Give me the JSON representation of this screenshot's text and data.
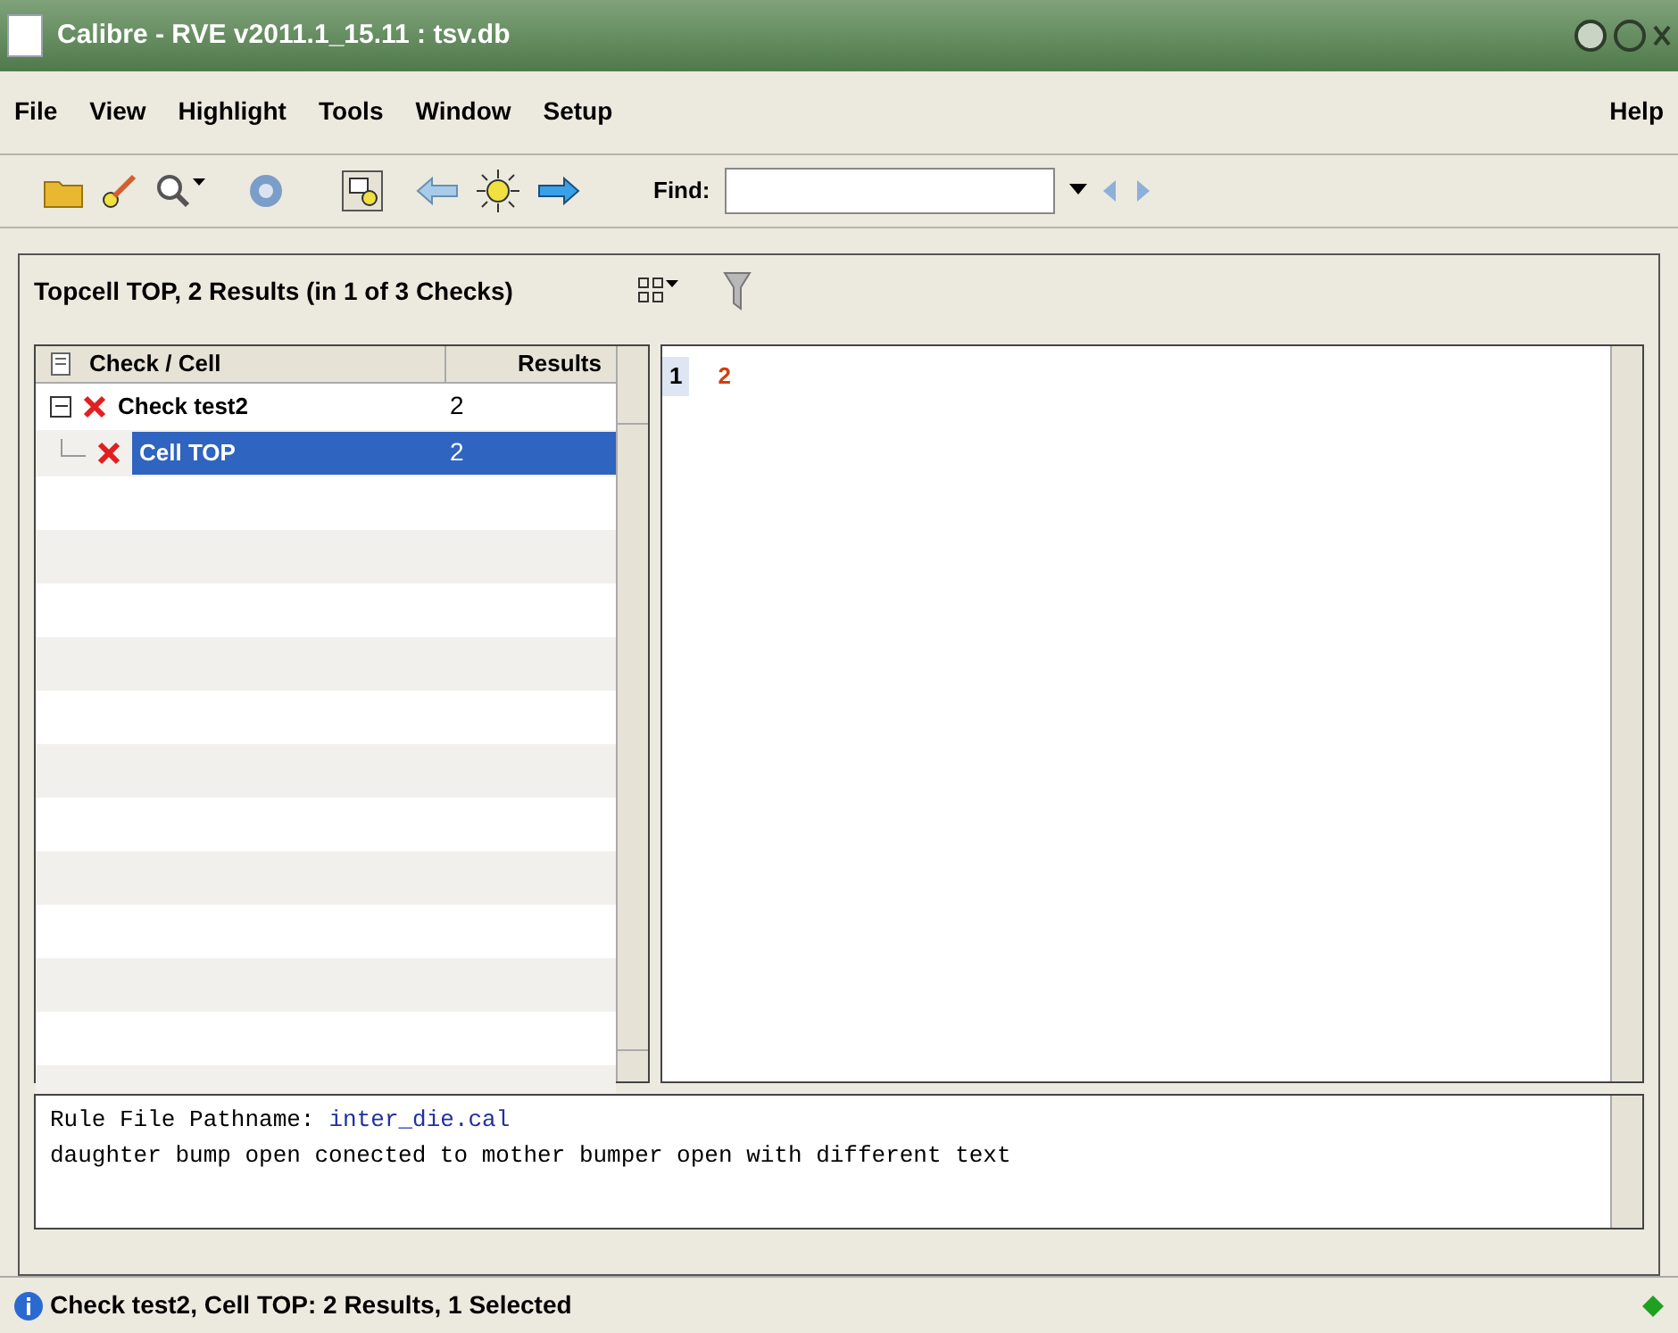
{
  "window": {
    "title": "Calibre - RVE v2011.1_15.11 : tsv.db"
  },
  "menu": [
    {
      "label": "File"
    },
    {
      "label": "View"
    },
    {
      "label": "Highlight"
    },
    {
      "label": "Tools"
    },
    {
      "label": "Window"
    },
    {
      "label": "Setup"
    }
  ],
  "help_menu": {
    "label": "Help"
  },
  "find": {
    "label": "Find:"
  },
  "summary": {
    "text": "Topcell TOP, 2 Results (in 1 of 3 Checks)"
  },
  "tree": {
    "columns": [
      "Check / Cell",
      "Results"
    ],
    "rows": [
      {
        "name": "Check test2",
        "results": "2",
        "selected": false,
        "expanded": true,
        "children": [
          {
            "name": "Cell TOP",
            "results": "2",
            "selected": true
          }
        ]
      }
    ]
  },
  "results": [
    {
      "index": "1",
      "value": "2"
    }
  ],
  "details": {
    "label": "Rule File Pathname:",
    "file": "inter_die.cal",
    "message": "daughter bump open conected to mother bumper open with different text"
  },
  "status_bar": {
    "text": "Check test2, Cell TOP: 2 Results, 1 Selected"
  }
}
